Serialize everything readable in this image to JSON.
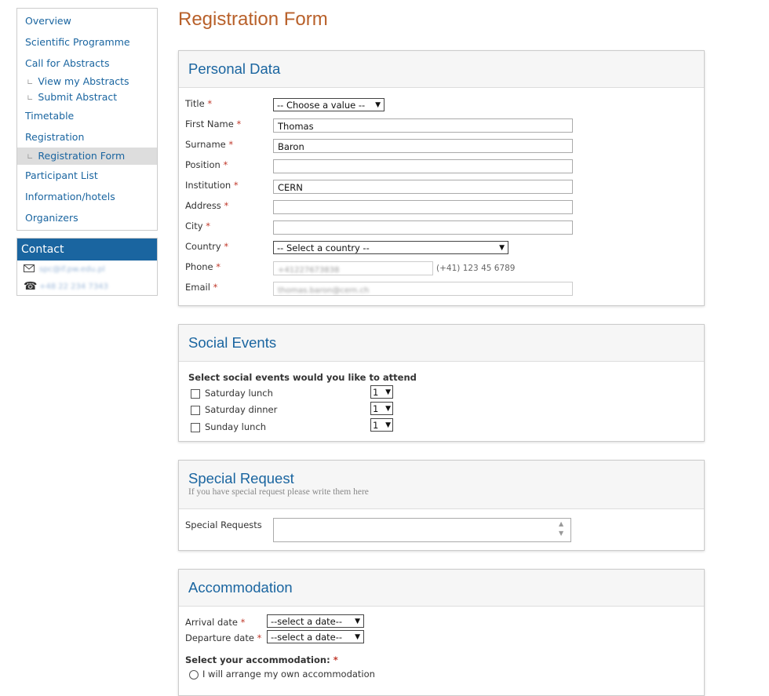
{
  "sidebar": {
    "items": [
      {
        "label": "Overview"
      },
      {
        "label": "Scientific Programme"
      },
      {
        "label": "Call for Abstracts"
      },
      {
        "label": "View my Abstracts"
      },
      {
        "label": "Submit Abstract"
      },
      {
        "label": "Timetable"
      },
      {
        "label": "Registration"
      },
      {
        "label": "Registration Form"
      },
      {
        "label": "Participant List"
      },
      {
        "label": "Information/hotels"
      },
      {
        "label": "Organizers"
      }
    ],
    "contact": {
      "title": "Contact",
      "email": "spc@if.pw.edu.pl",
      "phone": "+48 22 234 7343",
      "email_icon": "envelope-icon",
      "phone_icon": "telephone-icon"
    }
  },
  "page": {
    "title": "Registration Form"
  },
  "personal": {
    "title": "Personal Data",
    "title_label": "Title",
    "title_value": "-- Choose a value --",
    "first_name_label": "First Name",
    "first_name_value": "Thomas",
    "surname_label": "Surname",
    "surname_value": "Baron",
    "position_label": "Position",
    "position_value": "",
    "institution_label": "Institution",
    "institution_value": "CERN",
    "address_label": "Address",
    "address_value": "",
    "city_label": "City",
    "city_value": "",
    "country_label": "Country",
    "country_value": "-- Select a country --",
    "phone_label": "Phone",
    "phone_value": "+41227673838",
    "phone_hint": "(+41) 123 45 6789",
    "email_label": "Email",
    "email_value": "thomas.baron@cern.ch",
    "required_mark": "*"
  },
  "social": {
    "title": "Social Events",
    "prompt": "Select social events would you like to attend",
    "events": [
      {
        "label": "Saturday lunch",
        "qty": "1"
      },
      {
        "label": "Saturday dinner",
        "qty": "1"
      },
      {
        "label": "Sunday lunch",
        "qty": "1"
      }
    ]
  },
  "special": {
    "title": "Special Request",
    "description": "If you have special request please write them here",
    "label": "Special Requests",
    "value": ""
  },
  "accommodation": {
    "title": "Accommodation",
    "arrival_label": "Arrival date",
    "arrival_value": "--select a date--",
    "departure_label": "Departure date",
    "departure_value": "--select a date--",
    "select_label": "Select your accommodation:",
    "option1": "I will arrange my own accommodation"
  }
}
